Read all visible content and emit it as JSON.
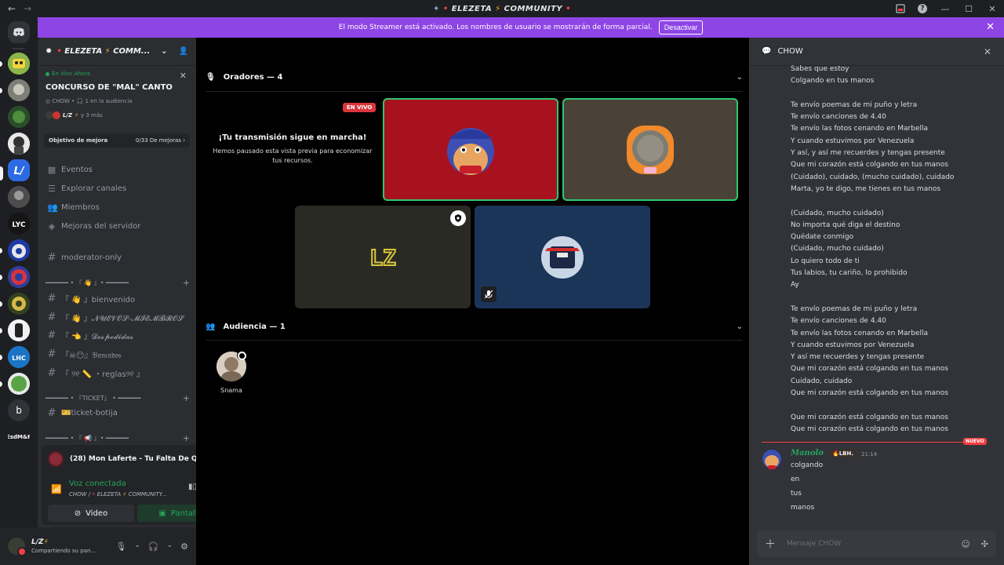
{
  "window": {
    "title": "ELEZETA",
    "title_suffix": "COMMUNITY"
  },
  "banner": {
    "text": "El modo Streamer está activado. Los nombres de usuario se mostrarán de forma parcial.",
    "button": "Desactivar"
  },
  "server": {
    "name": "ELEZETA",
    "name_suffix": "COMM..."
  },
  "event": {
    "live_label": "En Vivo Ahora",
    "title": "CONCURSO DE \"MAL\" CANTO",
    "channel": "CHOW",
    "audience": "1 en la audiencia",
    "host": "L/Z",
    "more": "y 3 más"
  },
  "goal": {
    "label": "Objetivo de mejora",
    "progress": "0/33 De mejoras"
  },
  "nav": [
    {
      "icon": "calendar-icon",
      "label": "Eventos"
    },
    {
      "icon": "explore-icon",
      "label": "Explorar canales"
    },
    {
      "icon": "members-icon",
      "label": "Miembros"
    },
    {
      "icon": "boost-icon",
      "label": "Mejoras del servidor"
    }
  ],
  "channels": {
    "moderator": "moderator-only",
    "cat1": "━━━━━━ • 『 👋 』• ━━━━━━",
    "bienvenido": "『 👋 』bienvenido",
    "nuevos": "『 👋 』𝓝𝓤𝓔𝓥𝓞𝓢-𝓜𝓘𝓔𝓜𝓑𝓡𝓞𝓢",
    "despedidas": "『 👈 』𝓓𝓮𝓼𝓹𝓮𝓭𝓲𝓭𝓪𝓼",
    "baneados": "『☠😶』𝔅𝔞𝔫𝔢𝔞𝔡𝔬𝔰",
    "reglas": "『 ୨୧ 📏 ・reglas୨୧ 』",
    "cat2": "━━━━━━ • 『TICKET』 • ━━━━━━",
    "ticket": "🎫ticket-botija",
    "cat3": "━━━━━━ • 『 📢 』• ━━━━━━"
  },
  "now_playing": {
    "title": "(28) Mon Laferte - Tu Falta De Quer..."
  },
  "voice": {
    "status": "Voz conectada",
    "sub_channel": "CHOW /",
    "sub_server": "ELEZETA",
    "sub_server_suffix": "COMMUNITY...",
    "video_label": "Video",
    "screen_label": "Pantalla"
  },
  "user": {
    "name": "L/Z",
    "status": "Compartiendo su pan..."
  },
  "stage": {
    "speakers_label": "Oradores — 4",
    "audience_label": "Audiencia — 1",
    "live_badge": "EN VIVO",
    "preview_title": "¡Tu transmisión sigue en marcha!",
    "preview_text": "Hemos pausado esta vista previa para economizar tus recursos.",
    "tile_logo": "LZ",
    "audience": [
      {
        "name": "Snama"
      }
    ]
  },
  "chat": {
    "title": "CHOW",
    "lyrics": [
      "Sabes que estoy",
      "Colgando en tus manos",
      "",
      "Te envío poemas de mi puño y letra",
      "Te envío canciones de 4.40",
      "Te envío las fotos cenando en Marbella",
      "Y cuando estuvimos por Venezuela",
      "Y así, y así me recuerdes y tengas presente",
      "Que mi corazón está colgando en tus manos",
      "(Cuidado), cuidado, (mucho cuidado), cuidado",
      "Marta, yo te digo, me tienes en tus manos",
      "",
      "(Cuidado, mucho cuidado)",
      "No importa qué diga el destino",
      "Quédate conmigo",
      "(Cuidado, mucho cuidado)",
      "Lo quiero todo de ti",
      "Tus labios, tu cariño, lo prohibido",
      "Ay",
      "",
      "Te envío poemas de mi puño y letra",
      "Te envío canciones de 4.40",
      "Te envío las fotos cenando en Marbella",
      "Y cuando estuvimos por Venezuela",
      "Y así me recuerdes y tengas presente",
      "Que mi corazón está colgando en tus manos",
      "Cuidado, cuidado",
      "Que mi corazón está colgando en tus manos",
      "",
      "Que mi corazón está colgando en tus manos",
      "Que mi corazón está colgando en tus manos"
    ],
    "new_label": "NUEVO",
    "message": {
      "author": "Manolo",
      "badge": "🔥LBH.",
      "time": "21:14",
      "lines": [
        "colgando",
        "en",
        "tus",
        "manos"
      ]
    },
    "input_placeholder": "Mensaje CHOW"
  }
}
